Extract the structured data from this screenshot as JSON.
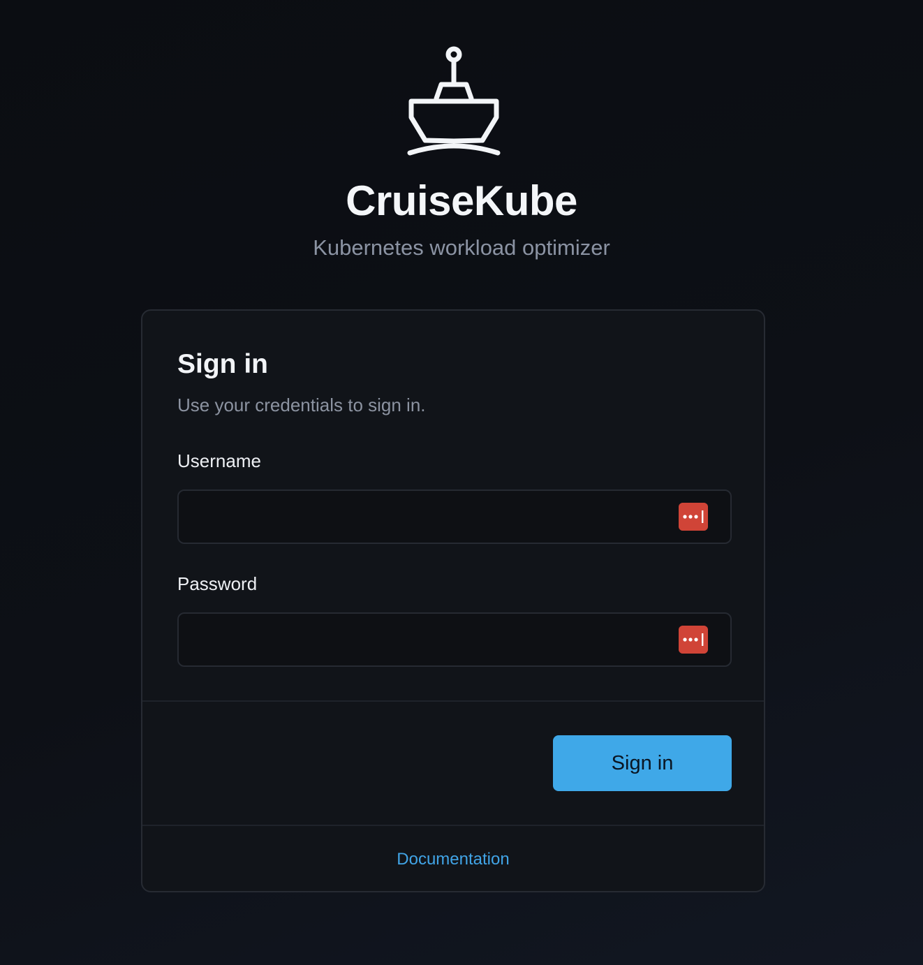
{
  "app": {
    "title": "CruiseKube",
    "subtitle": "Kubernetes workload optimizer",
    "logo_icon": "ship-icon"
  },
  "signin": {
    "title": "Sign in",
    "subtitle": "Use your credentials to sign in.",
    "username_label": "Username",
    "username_value": "",
    "password_label": "Password",
    "password_value": "",
    "password_manager_icon": "password-manager-icon",
    "submit_label": "Sign in",
    "documentation_link": "Documentation"
  },
  "colors": {
    "background": "#0d1016",
    "card": "#111419",
    "accent": "#3fa8e8",
    "link": "#41a4e6",
    "password_manager": "#d04437"
  }
}
